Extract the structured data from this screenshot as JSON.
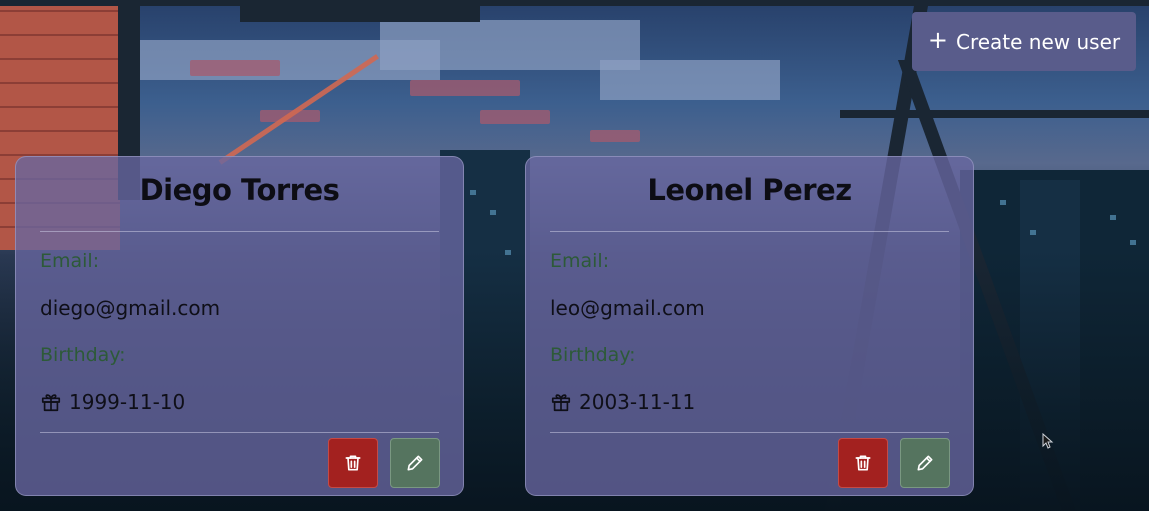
{
  "toolbar": {
    "create_label": "Create new user",
    "create_icon": "plus-icon"
  },
  "users": [
    {
      "name": "Diego Torres",
      "email_label": "Email:",
      "email": "diego@gmail.com",
      "birthday_label": "Birthday:",
      "birthday": "1999-11-10",
      "birthday_icon": "gift-icon",
      "delete_icon": "trash-icon",
      "edit_icon": "pencil-icon"
    },
    {
      "name": "Leonel Perez",
      "email_label": "Email:",
      "email": "leo@gmail.com",
      "birthday_label": "Birthday:",
      "birthday": "2003-11-11",
      "birthday_icon": "gift-icon",
      "delete_icon": "trash-icon",
      "edit_icon": "pencil-icon"
    }
  ],
  "colors": {
    "card_bg": "#6866a0",
    "create_button": "#595c8b",
    "delete_button": "#a3211f",
    "edit_button": "#55745f",
    "label_green": "#2d5a38"
  }
}
